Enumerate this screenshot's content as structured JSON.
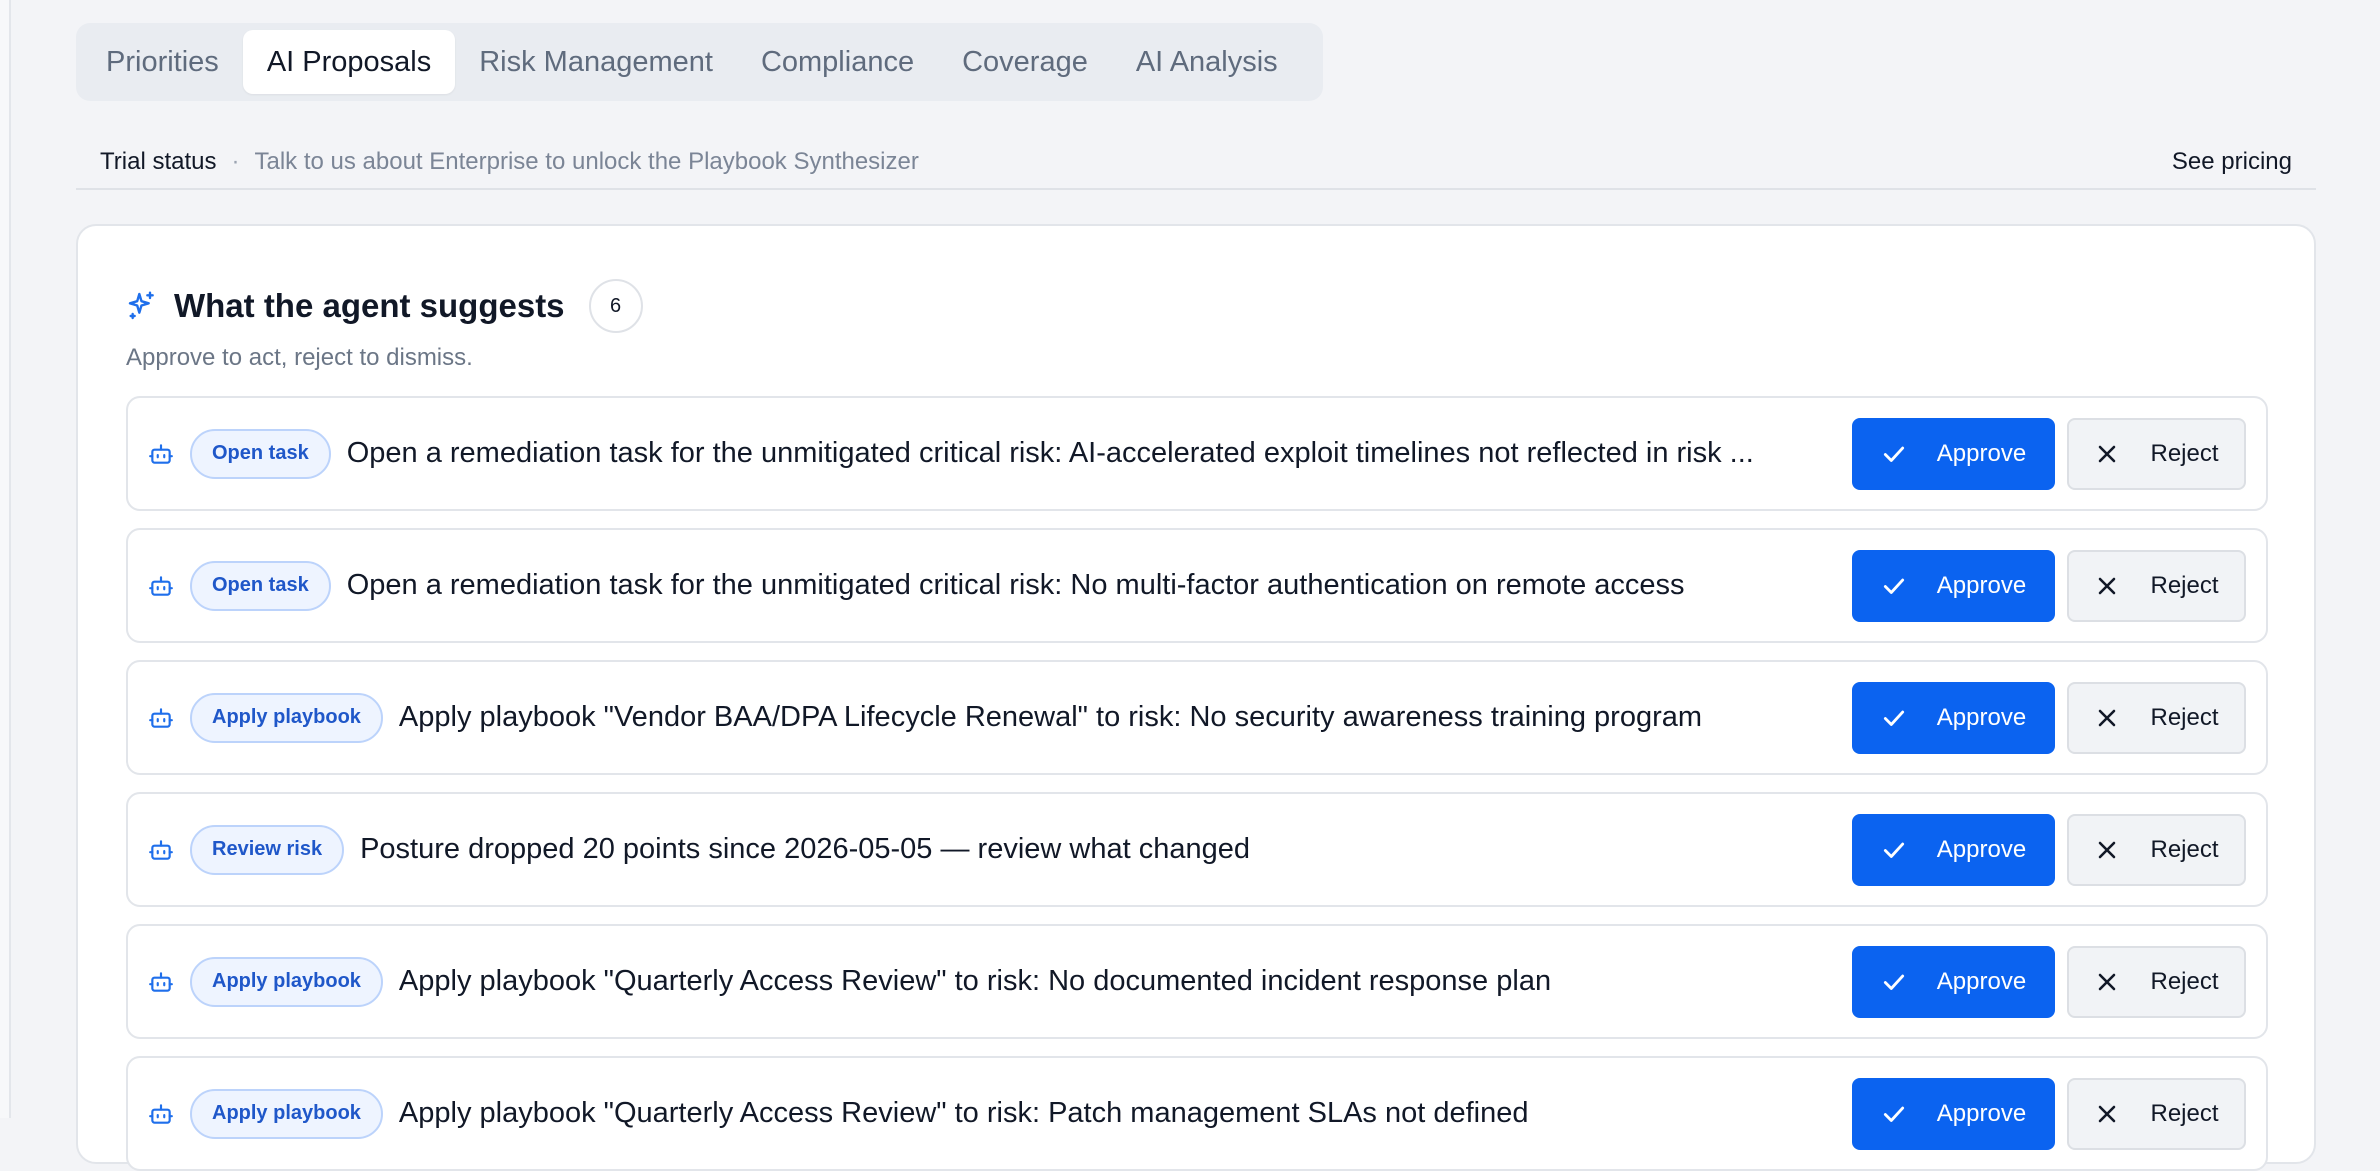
{
  "tabs": [
    {
      "label": "Priorities",
      "active": false
    },
    {
      "label": "AI Proposals",
      "active": true
    },
    {
      "label": "Risk Management",
      "active": false
    },
    {
      "label": "Compliance",
      "active": false
    },
    {
      "label": "Coverage",
      "active": false
    },
    {
      "label": "AI Analysis",
      "active": false
    }
  ],
  "trial": {
    "label": "Trial status",
    "separator": "·",
    "message": "Talk to us about Enterprise to unlock the Playbook Synthesizer",
    "pricing_link": "See pricing"
  },
  "suggestions": {
    "title": "What the agent suggests",
    "count": "6",
    "subtitle": "Approve to act, reject to dismiss.",
    "approve_label": "Approve",
    "reject_label": "Reject",
    "items": [
      {
        "tag": "Open task",
        "text": "Open a remediation task for the unmitigated critical risk: AI-accelerated exploit timelines not reflected in risk ..."
      },
      {
        "tag": "Open task",
        "text": "Open a remediation task for the unmitigated critical risk: No multi-factor authentication on remote access"
      },
      {
        "tag": "Apply playbook",
        "text": "Apply playbook \"Vendor BAA/DPA Lifecycle Renewal\" to risk: No security awareness training program"
      },
      {
        "tag": "Review risk",
        "text": "Posture dropped 20 points since 2026-05-05 — review what changed"
      },
      {
        "tag": "Apply playbook",
        "text": "Apply playbook \"Quarterly Access Review\" to risk: No documented incident response plan"
      },
      {
        "tag": "Apply playbook",
        "text": "Apply playbook \"Quarterly Access Review\" to risk: Patch management SLAs not defined"
      }
    ]
  },
  "colors": {
    "primary": "#0b63f0",
    "pill_bg": "#eef4ff",
    "pill_text": "#1f57c9",
    "background": "#f3f4f7"
  },
  "icons": {
    "header": "sparkles-icon",
    "row": "bot-icon",
    "approve": "check-icon",
    "reject": "x-icon"
  }
}
